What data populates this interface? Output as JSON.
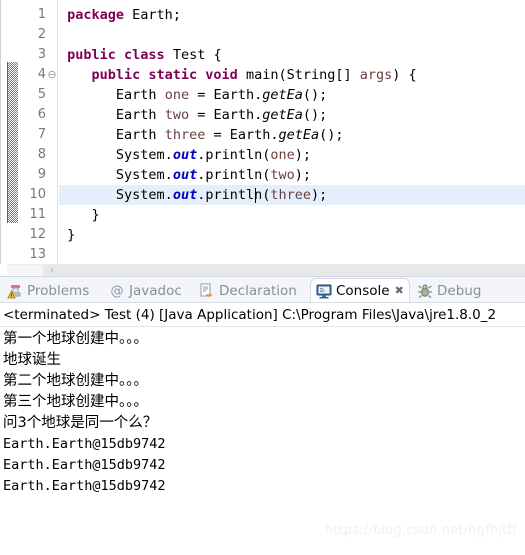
{
  "editor": {
    "name": "java-source-editor",
    "current_line": 10,
    "caret_line": 10,
    "folding_marker_line": 4,
    "colors": {
      "keyword": "#7f0055",
      "field": "#0000c0",
      "local_variable": "#6a3e3e",
      "current_line_highlight": "#e4effb",
      "fold_bar": "#4f7fc4"
    },
    "line_numbers": [
      "1",
      "2",
      "3",
      "4",
      "5",
      "6",
      "7",
      "8",
      "9",
      "10",
      "11",
      "12",
      "13"
    ],
    "lines": [
      {
        "n": "1",
        "indent": 0,
        "tokens": [
          {
            "t": "kw",
            "s": "package"
          },
          {
            "t": "id",
            "s": " Earth;"
          }
        ]
      },
      {
        "n": "2",
        "indent": 0,
        "tokens": []
      },
      {
        "n": "3",
        "indent": 0,
        "tokens": [
          {
            "t": "kw",
            "s": "public class"
          },
          {
            "t": "id",
            "s": " Test {"
          }
        ]
      },
      {
        "n": "4",
        "indent": 1,
        "tokens": [
          {
            "t": "kw",
            "s": "public static void"
          },
          {
            "t": "id",
            "s": " main(String[] "
          },
          {
            "t": "var",
            "s": "args"
          },
          {
            "t": "id",
            "s": ") {"
          }
        ]
      },
      {
        "n": "5",
        "indent": 2,
        "tokens": [
          {
            "t": "id",
            "s": "Earth "
          },
          {
            "t": "var",
            "s": "one"
          },
          {
            "t": "id",
            "s": " = Earth."
          },
          {
            "t": "mth",
            "s": "getEa"
          },
          {
            "t": "id",
            "s": "();"
          }
        ]
      },
      {
        "n": "6",
        "indent": 2,
        "tokens": [
          {
            "t": "id",
            "s": "Earth "
          },
          {
            "t": "var",
            "s": "two"
          },
          {
            "t": "id",
            "s": " = Earth."
          },
          {
            "t": "mth",
            "s": "getEa"
          },
          {
            "t": "id",
            "s": "();"
          }
        ]
      },
      {
        "n": "7",
        "indent": 2,
        "tokens": [
          {
            "t": "id",
            "s": "Earth "
          },
          {
            "t": "var",
            "s": "three"
          },
          {
            "t": "id",
            "s": " = Earth."
          },
          {
            "t": "mth",
            "s": "getEa"
          },
          {
            "t": "id",
            "s": "();"
          }
        ]
      },
      {
        "n": "8",
        "indent": 2,
        "tokens": [
          {
            "t": "id",
            "s": "System."
          },
          {
            "t": "fld",
            "s": "out"
          },
          {
            "t": "id",
            "s": ".println("
          },
          {
            "t": "var",
            "s": "one"
          },
          {
            "t": "id",
            "s": ");"
          }
        ]
      },
      {
        "n": "9",
        "indent": 2,
        "tokens": [
          {
            "t": "id",
            "s": "System."
          },
          {
            "t": "fld",
            "s": "out"
          },
          {
            "t": "id",
            "s": ".println("
          },
          {
            "t": "var",
            "s": "two"
          },
          {
            "t": "id",
            "s": ");"
          }
        ]
      },
      {
        "n": "10",
        "indent": 2,
        "tokens": [
          {
            "t": "id",
            "s": "System."
          },
          {
            "t": "fld",
            "s": "out"
          },
          {
            "t": "id",
            "s": ".println("
          },
          {
            "t": "var",
            "s": "three"
          },
          {
            "t": "id",
            "s": ");"
          }
        ]
      },
      {
        "n": "11",
        "indent": 1,
        "tokens": [
          {
            "t": "id",
            "s": "}"
          }
        ]
      },
      {
        "n": "12",
        "indent": 0,
        "tokens": [
          {
            "t": "id",
            "s": "}"
          }
        ]
      },
      {
        "n": "13",
        "indent": 0,
        "tokens": []
      }
    ],
    "hscroll_left_arrow": "‹"
  },
  "tabs": [
    {
      "label": "Problems",
      "icon": "problems-icon",
      "active": false,
      "closable": false
    },
    {
      "label": "Javadoc",
      "icon": "javadoc-icon",
      "active": false,
      "closable": false
    },
    {
      "label": "Declaration",
      "icon": "declaration-icon",
      "active": false,
      "closable": false
    },
    {
      "label": "Console",
      "icon": "console-icon",
      "active": true,
      "closable": true
    },
    {
      "label": "Debug",
      "icon": "debug-icon",
      "active": false,
      "closable": false
    }
  ],
  "tab_close_glyph": "✖",
  "console": {
    "name": "console-view",
    "launch_status": "<terminated> Test (4) [Java Application] C:\\Program Files\\Java\\jre1.8.0_2",
    "output_lines": [
      {
        "text": "第一个地球创建中。。。",
        "mono": false
      },
      {
        "text": "地球诞生",
        "mono": false
      },
      {
        "text": "第二个地球创建中。。。",
        "mono": false
      },
      {
        "text": "第三个地球创建中。。。",
        "mono": false
      },
      {
        "text": "问3个地球是同一个么？",
        "mono": false
      },
      {
        "text": "Earth.Earth@15db9742",
        "mono": true
      },
      {
        "text": "Earth.Earth@15db9742",
        "mono": true
      },
      {
        "text": "Earth.Earth@15db9742",
        "mono": true
      }
    ]
  },
  "watermark": {
    "text": "https://blog.csdn.net/hgfhjtff"
  }
}
